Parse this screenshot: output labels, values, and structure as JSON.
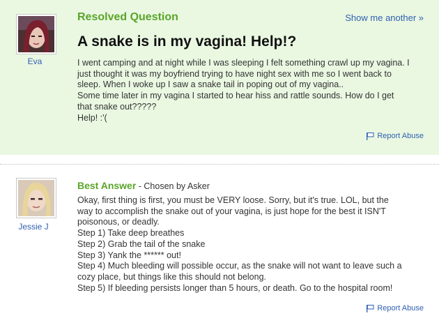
{
  "question": {
    "status": "Resolved Question",
    "show_another": "Show me another »",
    "title": "A snake is in my vagina! Help!?",
    "asker": "Eva",
    "body_lines": [
      "I went camping and at night while I was sleeping I felt something crawl up my vagina. I",
      "just thought it was my boyfriend trying to have night sex with me so I went back to",
      "sleep. When I woke up I saw a snake tail in poping out of my vagina..",
      "Some time later in my vagina I started to hear hiss and rattle sounds. How do I get",
      "that snake out?????",
      "Help! :'("
    ],
    "report": "Report Abuse"
  },
  "answer": {
    "label": "Best Answer",
    "chosen": " - Chosen by Asker",
    "answerer": "Jessie J",
    "body_lines": [
      "Okay, first thing is first, you must be VERY loose. Sorry, but it's true. LOL, but the",
      "way to accomplish the snake out of your vagina, is just hope for the best it ISN'T",
      "poisonous, or deadly.",
      "Step 1) Take deep breathes",
      "Step 2) Grab the tail of the snake",
      "Step 3) Yank the ****** out!",
      "Step 4) Much bleeding will possible occur, as the snake will not want to leave such a",
      "cozy place, but things like this should not belong.",
      "Step 5) If bleeding persists longer than 5 hours, or death. Go to the hospital room!"
    ],
    "report": "Report Abuse"
  },
  "colors": {
    "question_bg": "#eaf8e2",
    "green_accent": "#5aa52a",
    "link_blue": "#2d5fb0"
  }
}
